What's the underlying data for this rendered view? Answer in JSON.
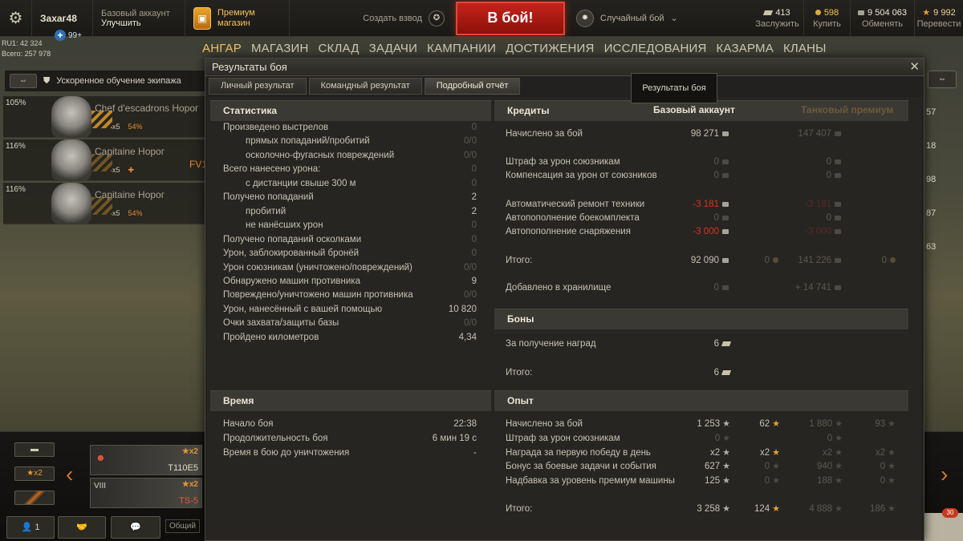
{
  "topbar": {
    "username": "Захаг48",
    "notifications": "99+",
    "account_type": "Базовый аккаунт",
    "upgrade": "Улучшить",
    "premium_l1": "Премиум",
    "premium_l2": "магазин",
    "create_platoon": "Создать взвод",
    "battle_button": "В бой!",
    "battle_mode": "Случайный бой",
    "currencies": [
      {
        "value": "413",
        "label": "Заслужить",
        "icon": "bonds-icon"
      },
      {
        "value": "598",
        "label": "Купить",
        "icon": "gold-icon"
      },
      {
        "value": "9 504 063",
        "label": "Обменять",
        "icon": "credits-icon"
      },
      {
        "value": "9 992",
        "label": "Перевести",
        "icon": "free-xp-icon"
      }
    ]
  },
  "server": {
    "line1": "RU1: 42 324",
    "line2": "Всего: 257 978"
  },
  "nav": [
    "АНГАР",
    "МАГАЗИН",
    "СКЛАД",
    "ЗАДАЧИ",
    "КАМПАНИИ",
    "ДОСТИЖЕНИЯ",
    "ИССЛЕДОВАНИЯ",
    "КАЗАРМА",
    "КЛАНЫ"
  ],
  "crew_header": "Ускоренное обучение экипажа",
  "crew": [
    {
      "pct": "105%",
      "rank": "Chef d'escadrons Норог",
      "sk1": "x5",
      "sk2": "54%"
    },
    {
      "pct": "116%",
      "rank": "Capitaine Норог",
      "sk1": "x5",
      "sk2": ""
    },
    {
      "pct": "116%",
      "rank": "Capitaine Норог",
      "sk1": "x5",
      "sk2": "54%"
    }
  ],
  "side_label": "FV1",
  "right_strip": [
    "57",
    "18",
    "98",
    "87",
    "63"
  ],
  "carousel": {
    "filter_x2": "★x2",
    "tanks": [
      {
        "name": "T110E5",
        "mult": "★x2",
        "red": false
      },
      {
        "name": "TS-5",
        "mult": "★x2",
        "red": true,
        "tier": "VIII"
      }
    ],
    "btn_count": "1",
    "general": "Общий",
    "notif_count": "30"
  },
  "dialog": {
    "title": "Результаты боя",
    "tabs": [
      "Личный результат",
      "Командный результат",
      "Подробный отчёт"
    ],
    "tooltip": "Результаты боя",
    "stats_title": "Статистика",
    "stats": [
      {
        "label": "Произведено выстрелов",
        "value": "0",
        "indent": false,
        "dim": true
      },
      {
        "label": "прямых попаданий/пробитий",
        "value": "0/0",
        "indent": true,
        "dim": true
      },
      {
        "label": "осколочно-фугасных повреждений",
        "value": "0/0",
        "indent": true,
        "dim": true
      },
      {
        "label": "Всего нанесено урона:",
        "value": "0",
        "indent": false,
        "dim": true
      },
      {
        "label": "с дистанции свыше 300 м",
        "value": "0",
        "indent": true,
        "dim": true
      },
      {
        "label": "Получено попаданий",
        "value": "2",
        "indent": false,
        "dim": false
      },
      {
        "label": "пробитий",
        "value": "2",
        "indent": true,
        "dim": false
      },
      {
        "label": "не нанёсших урон",
        "value": "0",
        "indent": true,
        "dim": true
      },
      {
        "label": "Получено попаданий осколками",
        "value": "0",
        "indent": false,
        "dim": true
      },
      {
        "label": "Урон, заблокированный бронёй",
        "value": "0",
        "indent": false,
        "dim": true
      },
      {
        "label": "Урон союзникам (уничтожено/повреждений)",
        "value": "0/0",
        "indent": false,
        "dim": true
      },
      {
        "label": "Обнаружено машин противника",
        "value": "9",
        "indent": false,
        "dim": false
      },
      {
        "label": "Повреждено/уничтожено машин противника",
        "value": "0/0",
        "indent": false,
        "dim": true
      },
      {
        "label": "Урон, нанесённый с вашей помощью",
        "value": "10 820",
        "indent": false,
        "dim": false
      },
      {
        "label": "Очки захвата/защиты базы",
        "value": "0/0",
        "indent": false,
        "dim": true
      },
      {
        "label": "Пройдено километров",
        "value": "4,34",
        "indent": false,
        "dim": false
      }
    ],
    "time_title": "Время",
    "time": [
      {
        "label": "Начало боя",
        "value": "22:38"
      },
      {
        "label": "Продолжительность боя",
        "value": "6 мин 19 с"
      },
      {
        "label": "Время в бою до уничтожения",
        "value": "-"
      }
    ],
    "credits_title": "Кредиты",
    "col_basic": "Базовый аккаунт",
    "col_premium": "Танковый премиум",
    "credits": [
      {
        "label": "Начислено за бой",
        "b": "98 271",
        "bg": "",
        "p": "147 407",
        "pg": "",
        "style": "normal"
      },
      {
        "label": "Штраф за урон союзникам",
        "b": "0",
        "bg": "",
        "p": "0",
        "pg": "",
        "style": "dim"
      },
      {
        "label": "Компенсация за урон от союзников",
        "b": "0",
        "bg": "",
        "p": "0",
        "pg": "",
        "style": "dim"
      },
      {
        "label": "Автоматический ремонт техники",
        "b": "-3 181",
        "bg": "",
        "p": "-3 181",
        "pg": "",
        "style": "neg"
      },
      {
        "label": "Автопополнение боекомплекта",
        "b": "0",
        "bg": "",
        "p": "0",
        "pg": "",
        "style": "dim"
      },
      {
        "label": "Автопополнение снаряжения",
        "b": "-3 000",
        "bg": "",
        "p": "-3 000",
        "pg": "",
        "style": "neg"
      },
      {
        "label": "Итого:",
        "b": "92 090",
        "bg": "0",
        "p": "141 226",
        "pg": "0",
        "style": "normal"
      },
      {
        "label": "Добавлено в хранилище",
        "b": "0",
        "bg": "",
        "p": "+ 14 741",
        "pg": "",
        "style": "dim"
      }
    ],
    "bonds_title": "Боны",
    "bonds": [
      {
        "label": "За получение наград",
        "value": "6"
      },
      {
        "label": "Итого:",
        "value": "6"
      }
    ],
    "xp_title": "Опыт",
    "xp": [
      {
        "label": "Начислено за бой",
        "b": "1 253",
        "bf": "62",
        "p": "1 880",
        "pf": "93",
        "bd": false,
        "bfd": false
      },
      {
        "label": "Штраф за урон союзникам",
        "b": "0",
        "bf": "",
        "p": "0",
        "pf": "",
        "bd": true,
        "bfd": true
      },
      {
        "label": "Награда за первую победу в день",
        "b": "x2",
        "bf": "x2",
        "p": "x2",
        "pf": "x2",
        "bd": false,
        "bfd": false
      },
      {
        "label": "Бонус за боевые задачи и события",
        "b": "627",
        "bf": "0",
        "p": "940",
        "pf": "0",
        "bd": false,
        "bfd": true
      },
      {
        "label": "Надбавка за уровень премиум машины",
        "b": "125",
        "bf": "0",
        "p": "188",
        "pf": "0",
        "bd": false,
        "bfd": true
      },
      {
        "label": "Итого:",
        "b": "3 258",
        "bf": "124",
        "p": "4 888",
        "pf": "186",
        "bd": false,
        "bfd": false
      }
    ]
  }
}
